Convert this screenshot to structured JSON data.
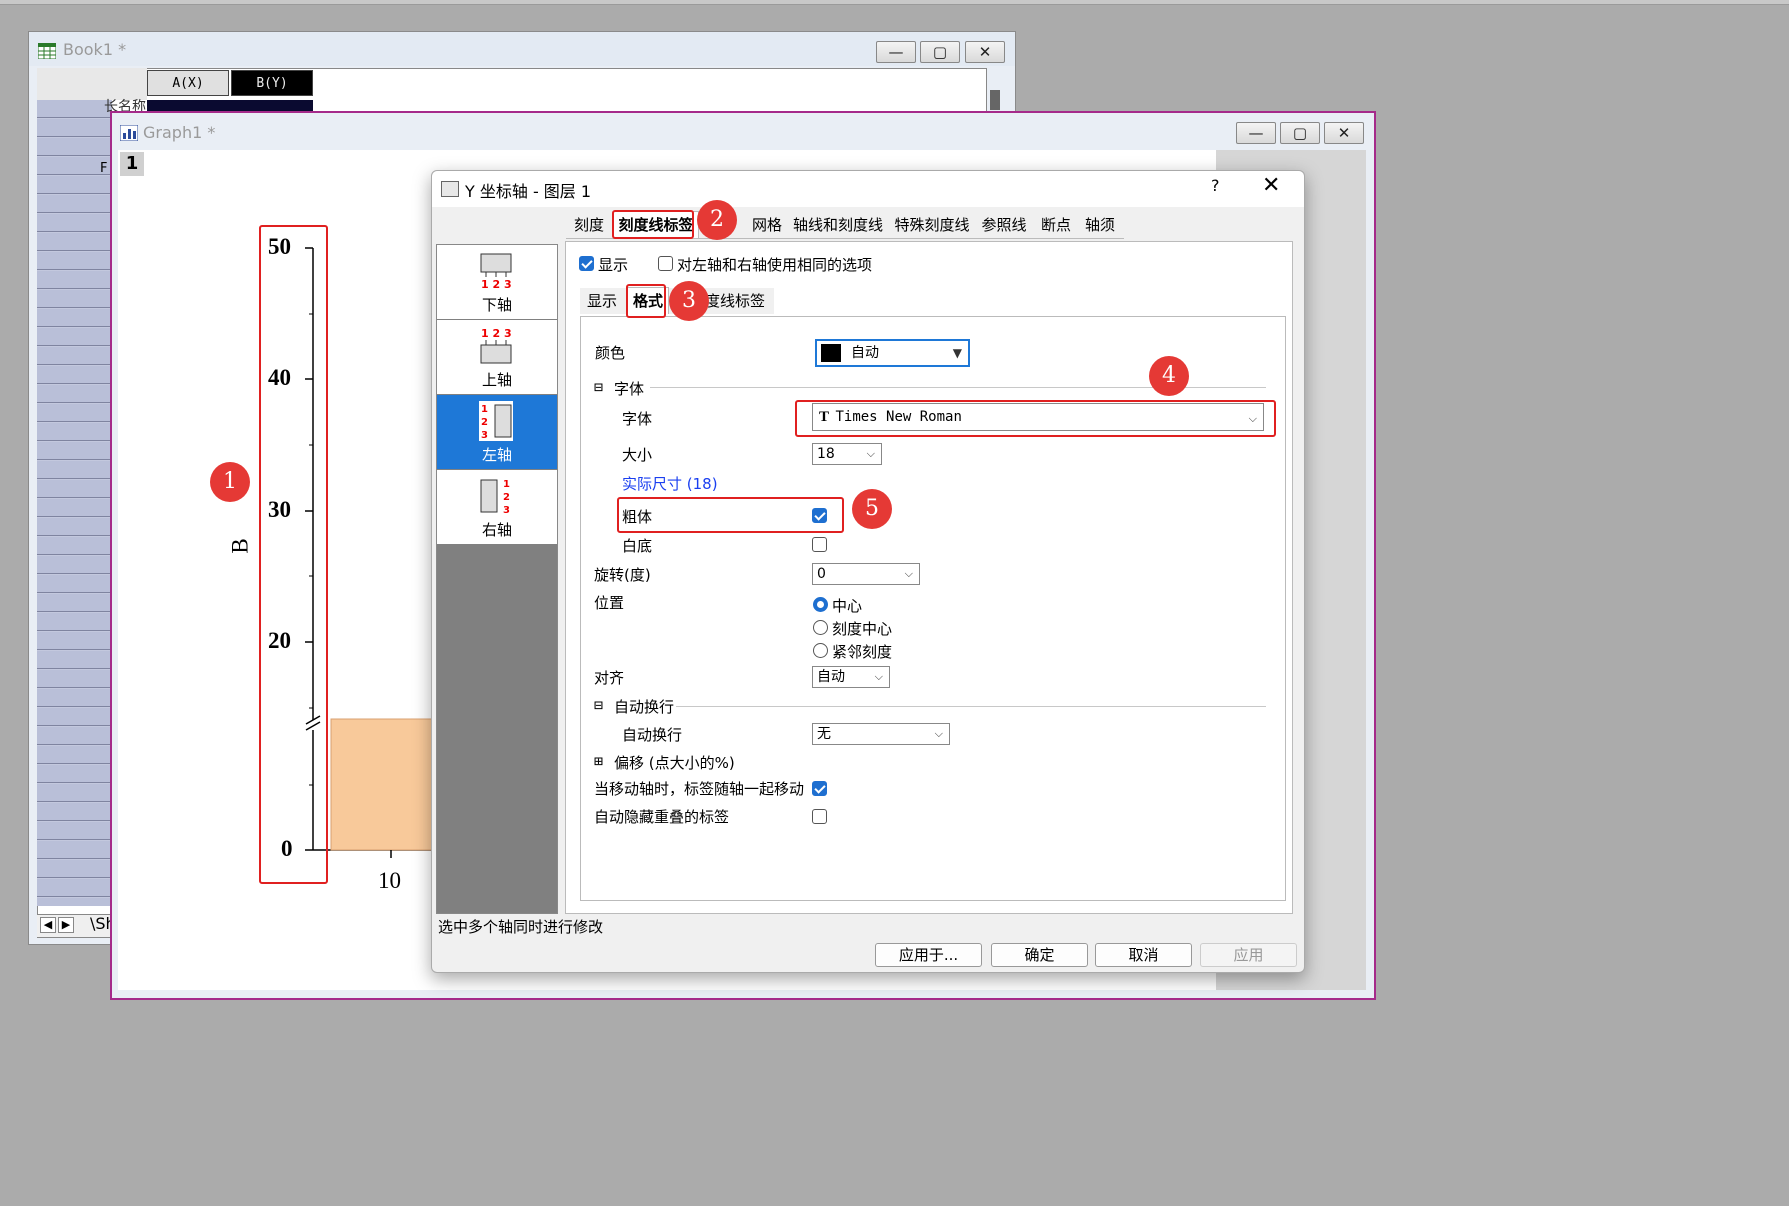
{
  "book": {
    "title": "Book1 *",
    "col_a": "A(X)",
    "col_b": "B(Y)",
    "row_label_longname": "长名称",
    "row_label_f": "F",
    "sheet_tab": "\\Sh"
  },
  "graph": {
    "title": "Graph1 *",
    "layer_number": "1",
    "y_axis_title": "B",
    "y_ticks": [
      "50",
      "40",
      "30",
      "20",
      "0"
    ],
    "x_tick": "10",
    "bar_color": "#f8c99a"
  },
  "dialog": {
    "title": "Y 坐标轴 - 图层 1",
    "help": "?",
    "close": "✕",
    "tabs": [
      "刻度",
      "刻度线标签",
      "网格",
      "轴线和刻度线",
      "特殊刻度线",
      "参照线",
      "断点",
      "轴须"
    ],
    "axes": [
      {
        "label": "下轴",
        "icon": "bottom-axis-icon"
      },
      {
        "label": "上轴",
        "icon": "top-axis-icon"
      },
      {
        "label": "左轴",
        "icon": "left-axis-icon"
      },
      {
        "label": "右轴",
        "icon": "right-axis-icon"
      }
    ],
    "show_label": "显示",
    "same_opts_label": "对左轴和右轴使用相同的选项",
    "subtabs": [
      "显示",
      "格式",
      "次刻度线标签"
    ],
    "color_label": "颜色",
    "color_value": "自动",
    "font_section": "字体",
    "font_label": "字体",
    "font_value": "Times New Roman",
    "size_label": "大小",
    "size_value": "18",
    "actual_size": "实际尺寸 (18)",
    "bold_label": "粗体",
    "white_bg_label": "白底",
    "rotate_label": "旋转(度)",
    "rotate_value": "0",
    "position_label": "位置",
    "position_options": [
      "中心",
      "刻度中心",
      "紧邻刻度"
    ],
    "align_label": "对齐",
    "align_value": "自动",
    "wrap_section": "自动换行",
    "wrap_label": "自动换行",
    "wrap_value": "无",
    "offset_section": "偏移 (点大小的%)",
    "move_with_axis_label": "当移动轴时，标签随轴一起移动",
    "hide_overlap_label": "自动隐藏重叠的标签",
    "status_text": "选中多个轴同时进行修改",
    "buttons": {
      "apply_to": "应用于...",
      "ok": "确定",
      "cancel": "取消",
      "apply": "应用"
    }
  },
  "annotations": [
    "1",
    "2",
    "3",
    "4",
    "5"
  ],
  "colors": {
    "highlight": "#e02020",
    "badge": "#e53935",
    "accent": "#1e78d7",
    "graph_border": "#a52a8a"
  }
}
